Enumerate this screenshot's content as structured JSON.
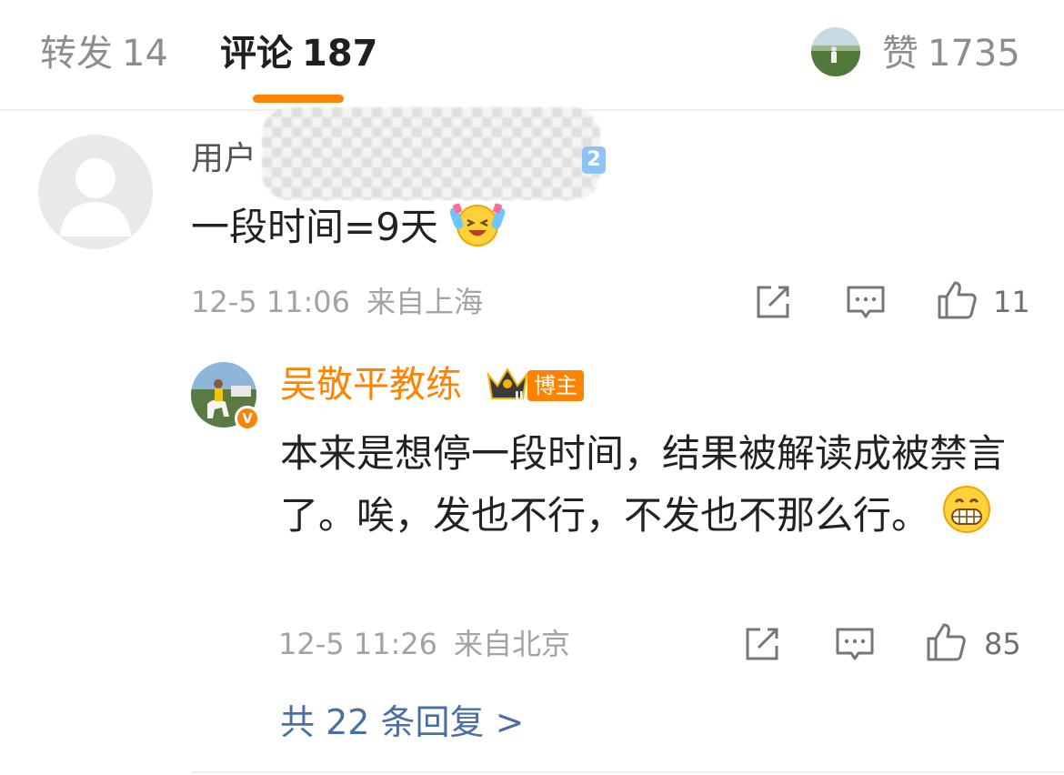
{
  "tabs": {
    "repost": {
      "label": "转发",
      "count": "14"
    },
    "comment": {
      "label": "评论",
      "count": "187"
    },
    "likes": {
      "label": "赞",
      "count": "1735"
    }
  },
  "colors": {
    "accent": "#ff8200",
    "link": "#4a6fa5",
    "meta": "#a3a3a3"
  },
  "comment": {
    "username_visible": "用户",
    "level": "2",
    "text": "一段时间=9天",
    "emoji": "laughing-tears-emoji",
    "date": "12-5 11:06",
    "location": "来自上海",
    "like_count": "11"
  },
  "reply": {
    "author": "吴敬平教练",
    "author_badge": "博主",
    "crown_mark": "II",
    "verified_mark": "V",
    "text": "本来是想停一段时间，结果被解读成被禁言了。唉，发也不行，不发也不那么行。",
    "emoji": "grinning-emoji",
    "date": "12-5 11:26",
    "location": "来自北京",
    "like_count": "85"
  },
  "view_replies": "共 22 条回复 >"
}
